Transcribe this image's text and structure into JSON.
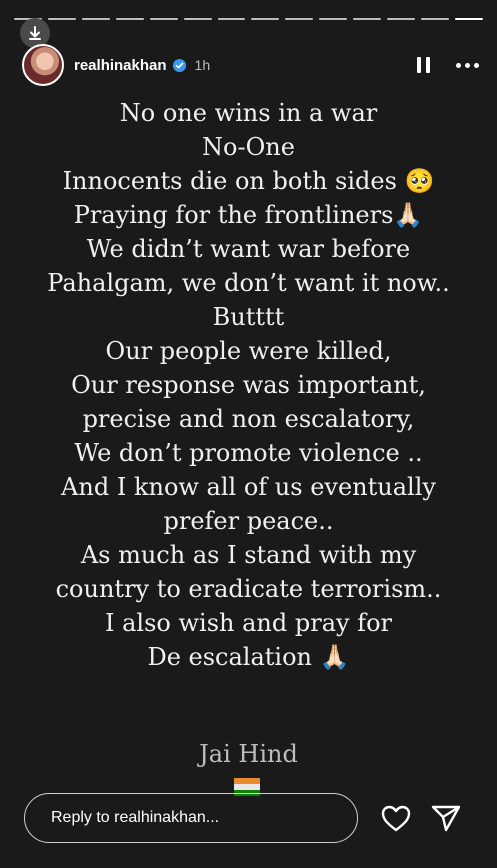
{
  "story": {
    "progress_segments": 14,
    "active_segment": 13,
    "username": "realhinakhan",
    "time_ago": "1h",
    "lines": [
      "No one wins in a war",
      "No-One",
      "Innocents die on both sides 🥺",
      "Praying for the frontliners🙏🏻",
      "We didn’t want war before",
      "Pahalgam, we don’t want it now..",
      "Butttt",
      "Our people were killed,",
      "Our response was important,",
      "precise and non escalatory,",
      "We don’t promote violence ..",
      "And I know all of us eventually",
      "prefer peace..",
      "As much as I stand with my",
      "country to eradicate terrorism..",
      "I also wish and pray for",
      "De escalation 🙏🏻"
    ],
    "signoff": "Jai Hind"
  },
  "reply": {
    "placeholder": "Reply to realhinakhan..."
  },
  "icons": {
    "download": "download-icon",
    "verified": "verified-badge-icon",
    "pause": "pause-icon",
    "more": "more-icon",
    "heart": "heart-icon",
    "send": "send-icon",
    "flag": "india-flag-icon"
  },
  "colors": {
    "background": "#1a1a1a",
    "text": "#f0f0f0",
    "verified": "#3897f0",
    "flag_saffron": "#ff9933",
    "flag_white": "#ffffff",
    "flag_green": "#138808"
  }
}
